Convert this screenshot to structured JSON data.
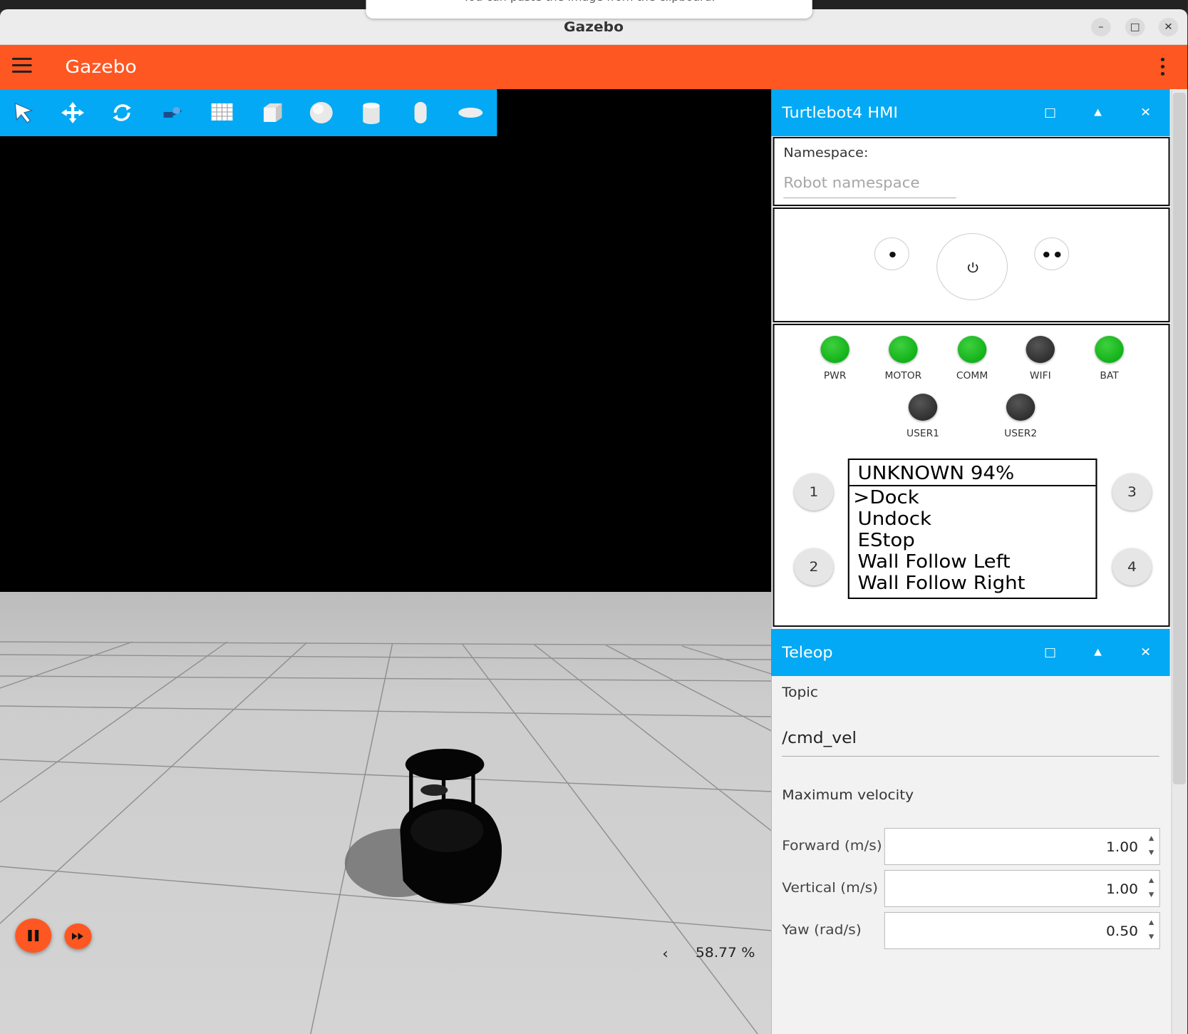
{
  "window": {
    "title": "Gazebo",
    "toast": "You can paste the image from the clipboard."
  },
  "app": {
    "title": "Gazebo"
  },
  "toolbar_tools": [
    "select-mode",
    "translate-mode",
    "rotate-mode",
    "transform-control",
    "grid-config",
    "box-shape",
    "sphere-shape",
    "cylinder-shape",
    "capsule-shape",
    "ellipsoid-shape"
  ],
  "viewport": {
    "rtf": "58.77 %",
    "rtf_chevron": "‹"
  },
  "hmi": {
    "title": "Turtlebot4 HMI",
    "namespace_label": "Namespace:",
    "namespace_placeholder": "Robot namespace",
    "leds": [
      {
        "label": "PWR",
        "color": "#12b21a"
      },
      {
        "label": "MOTOR",
        "color": "#12b21a"
      },
      {
        "label": "COMM",
        "color": "#12b21a"
      },
      {
        "label": "WIFI",
        "color": "#2f2f2f"
      },
      {
        "label": "BAT",
        "color": "#12b21a"
      },
      {
        "label": "USER1",
        "color": "#2f2f2f"
      },
      {
        "label": "USER2",
        "color": "#2f2f2f"
      }
    ],
    "buttons": [
      "1",
      "2",
      "3",
      "4"
    ],
    "display": {
      "header": "UNKNOWN 94%",
      "items": [
        ">Dock",
        "Undock",
        "EStop",
        "Wall Follow Left",
        "Wall Follow Right"
      ]
    }
  },
  "teleop": {
    "title": "Teleop",
    "topic_label": "Topic",
    "topic_value": "/cmd_vel",
    "maxvel_label": "Maximum velocity",
    "forward_label": "Forward (m/s)",
    "forward_value": "1.00",
    "vertical_label": "Vertical (m/s)",
    "vertical_value": "1.00",
    "yaw_label": "Yaw (rad/s)",
    "yaw_value": "0.50"
  },
  "panel_controls": {
    "maximize": "□",
    "collapse": "▲",
    "close": "✕"
  },
  "colors": {
    "accent_orange": "#fe5722",
    "accent_blue": "#03a9f4",
    "led_on": "#12b21a",
    "led_off": "#2f2f2f"
  }
}
